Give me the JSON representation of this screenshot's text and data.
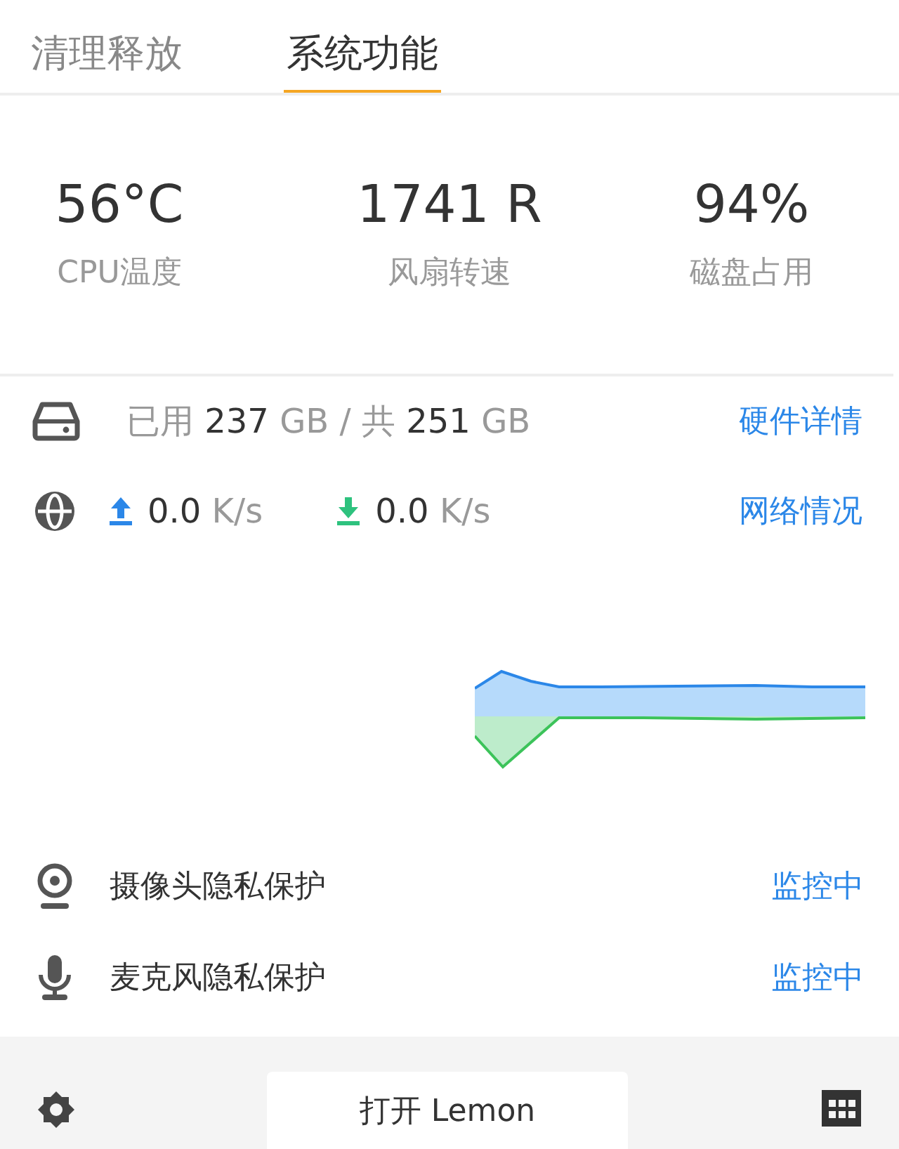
{
  "tabs": [
    {
      "label": "清理释放",
      "selected": false
    },
    {
      "label": "系统功能",
      "selected": true
    }
  ],
  "stats": [
    {
      "value": "56°C",
      "label": "CPU温度"
    },
    {
      "value": "1741 R",
      "label": "风扇转速"
    },
    {
      "value": "94%",
      "label": "磁盘占用"
    }
  ],
  "storage": {
    "text": "已用 **237** GB / 共 **251** GB",
    "link": "硬件详情"
  },
  "network": {
    "upload": "**0.0** K/s",
    "download": "**0.0** K/s",
    "link": "网络情况"
  },
  "privacy": [
    {
      "kind": "camera",
      "label": "摄像头隐私保护",
      "status": "监控中"
    },
    {
      "kind": "microphone",
      "label": "麦克风隐私保护",
      "status": "监控中"
    }
  ],
  "footer": {
    "button": "打开 Lemon"
  }
}
